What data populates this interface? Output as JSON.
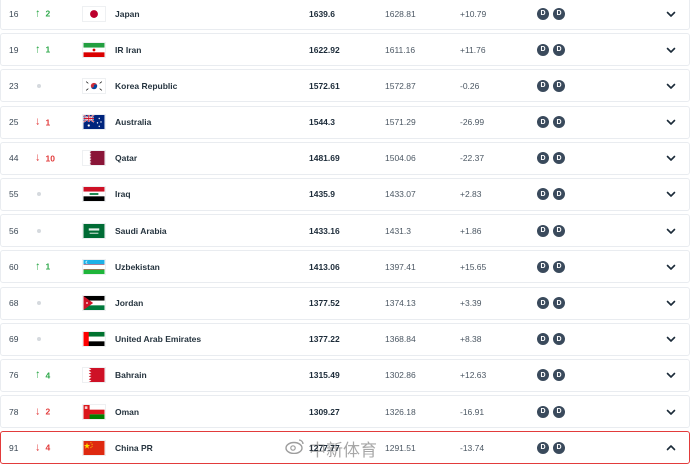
{
  "rows": [
    {
      "rank": "16",
      "move_dir": "up",
      "move": "2",
      "flag": "japan-flag",
      "team": "Japan",
      "points": "1639.6",
      "prev": "1628.81",
      "diff": "+10.79",
      "badge1": "D",
      "badge2": "D"
    },
    {
      "rank": "19",
      "move_dir": "up",
      "move": "1",
      "flag": "iran-flag",
      "team": "IR Iran",
      "points": "1622.92",
      "prev": "1611.16",
      "diff": "+11.76",
      "badge1": "D",
      "badge2": "D"
    },
    {
      "rank": "23",
      "move_dir": "none",
      "move": "",
      "flag": "korea-flag",
      "team": "Korea Republic",
      "points": "1572.61",
      "prev": "1572.87",
      "diff": "-0.26",
      "badge1": "D",
      "badge2": "D"
    },
    {
      "rank": "25",
      "move_dir": "down",
      "move": "1",
      "flag": "australia-flag",
      "team": "Australia",
      "points": "1544.3",
      "prev": "1571.29",
      "diff": "-26.99",
      "badge1": "D",
      "badge2": "D"
    },
    {
      "rank": "44",
      "move_dir": "down",
      "move": "10",
      "flag": "qatar-flag",
      "team": "Qatar",
      "points": "1481.69",
      "prev": "1504.06",
      "diff": "-22.37",
      "badge1": "D",
      "badge2": "D"
    },
    {
      "rank": "55",
      "move_dir": "none",
      "move": "",
      "flag": "iraq-flag",
      "team": "Iraq",
      "points": "1435.9",
      "prev": "1433.07",
      "diff": "+2.83",
      "badge1": "D",
      "badge2": "D"
    },
    {
      "rank": "56",
      "move_dir": "none",
      "move": "",
      "flag": "saudi-flag",
      "team": "Saudi Arabia",
      "points": "1433.16",
      "prev": "1431.3",
      "diff": "+1.86",
      "badge1": "D",
      "badge2": "D"
    },
    {
      "rank": "60",
      "move_dir": "up",
      "move": "1",
      "flag": "uzbekistan-flag",
      "team": "Uzbekistan",
      "points": "1413.06",
      "prev": "1397.41",
      "diff": "+15.65",
      "badge1": "D",
      "badge2": "D"
    },
    {
      "rank": "68",
      "move_dir": "none",
      "move": "",
      "flag": "jordan-flag",
      "team": "Jordan",
      "points": "1377.52",
      "prev": "1374.13",
      "diff": "+3.39",
      "badge1": "D",
      "badge2": "D"
    },
    {
      "rank": "69",
      "move_dir": "none",
      "move": "",
      "flag": "uae-flag",
      "team": "United Arab Emirates",
      "points": "1377.22",
      "prev": "1368.84",
      "diff": "+8.38",
      "badge1": "D",
      "badge2": "D"
    },
    {
      "rank": "76",
      "move_dir": "up",
      "move": "4",
      "flag": "bahrain-flag",
      "team": "Bahrain",
      "points": "1315.49",
      "prev": "1302.86",
      "diff": "+12.63",
      "badge1": "D",
      "badge2": "D"
    },
    {
      "rank": "78",
      "move_dir": "down",
      "move": "2",
      "flag": "oman-flag",
      "team": "Oman",
      "points": "1309.27",
      "prev": "1326.18",
      "diff": "-16.91",
      "badge1": "D",
      "badge2": "D"
    },
    {
      "rank": "91",
      "move_dir": "down",
      "move": "4",
      "flag": "china-flag",
      "team": "China PR",
      "points": "1277.77",
      "prev": "1291.51",
      "diff": "-13.74",
      "badge1": "D",
      "badge2": "D",
      "expanded": true,
      "highlight": true
    }
  ],
  "watermark": "中新体育",
  "colors": {
    "up": "#2ea84a",
    "down": "#e23b3b",
    "highlight_border": "#e23b3b",
    "badge": "#3a4a5c"
  }
}
